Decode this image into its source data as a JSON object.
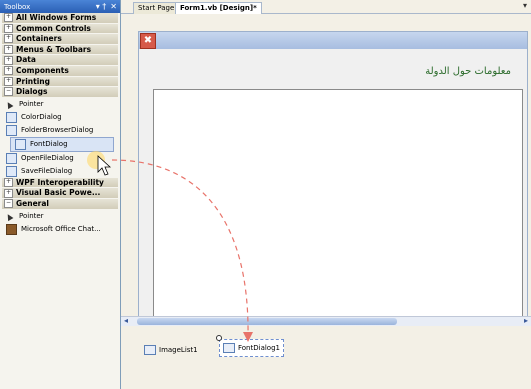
{
  "toolbox": {
    "title": "Toolbox",
    "pin": "▾ †",
    "close": "✕",
    "categories_top": [
      {
        "label": "All Windows Forms",
        "toggle": "+"
      },
      {
        "label": "Common Controls",
        "toggle": "+"
      },
      {
        "label": "Containers",
        "toggle": "+"
      },
      {
        "label": "Menus & Toolbars",
        "toggle": "+"
      },
      {
        "label": "Data",
        "toggle": "+"
      },
      {
        "label": "Components",
        "toggle": "+"
      },
      {
        "label": "Printing",
        "toggle": "+"
      },
      {
        "label": "Dialogs",
        "toggle": "−"
      }
    ],
    "dialog_items": [
      "Pointer",
      "ColorDialog",
      "FolderBrowserDialog",
      "FontDialog",
      "OpenFileDialog",
      "SaveFileDialog"
    ],
    "categories_mid": [
      {
        "label": "WPF Interoperability",
        "toggle": "+"
      },
      {
        "label": "Visual Basic Powe...",
        "toggle": "+"
      },
      {
        "label": "General",
        "toggle": "−"
      }
    ],
    "general_items": [
      "Pointer",
      "Microsoft Office Chat..."
    ]
  },
  "tabs": {
    "start_page": "Start Page",
    "form_design": "Form1.vb [Design]*",
    "dropdown": "▾"
  },
  "form": {
    "close_glyph": "✖",
    "arabic_label": "معلومات حول الدولة"
  },
  "scroll": {
    "left": "◂",
    "right": "▸"
  },
  "tray": {
    "imagelist": "ImageList1",
    "fontdialog": "FontDialog1"
  },
  "colors": {
    "accent": "#2a5fb4",
    "arrow": "#e8736a",
    "arabic_text": "#2a6a2a"
  }
}
